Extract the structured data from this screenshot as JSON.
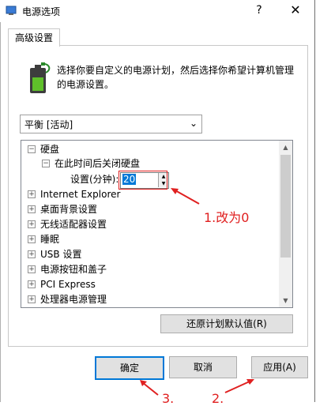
{
  "window": {
    "title": "电源选项",
    "help": "?",
    "close": "✕"
  },
  "tab": {
    "label": "高级设置"
  },
  "description": "选择你要自定义的电源计划，然后选择你希望计算机管理的电源设置。",
  "plan_select": {
    "value": "平衡 [活动]"
  },
  "tree": {
    "hard_disk": {
      "expander": "⊟",
      "label": "硬盘"
    },
    "turn_off": {
      "expander": "⊟",
      "label": "在此时间后关闭硬盘"
    },
    "setting": {
      "label": "设置(分钟):",
      "value": "20"
    },
    "items": [
      {
        "expander": "⊞",
        "label": "Internet Explorer"
      },
      {
        "expander": "⊞",
        "label": "桌面背景设置"
      },
      {
        "expander": "⊞",
        "label": "无线适配器设置"
      },
      {
        "expander": "⊞",
        "label": "睡眠"
      },
      {
        "expander": "⊞",
        "label": "USB 设置"
      },
      {
        "expander": "⊞",
        "label": "电源按钮和盖子"
      },
      {
        "expander": "⊞",
        "label": "PCI Express"
      },
      {
        "expander": "⊞",
        "label": "处理器电源管理"
      }
    ]
  },
  "buttons": {
    "restore": "还原计划默认值(R)",
    "ok": "确定",
    "cancel": "取消",
    "apply": "应用(A)"
  },
  "annotations": {
    "step1": "1.改为0",
    "step2": "2.",
    "step3": "3."
  },
  "colors": {
    "accent": "#0078d7",
    "annotation": "#e02020"
  }
}
